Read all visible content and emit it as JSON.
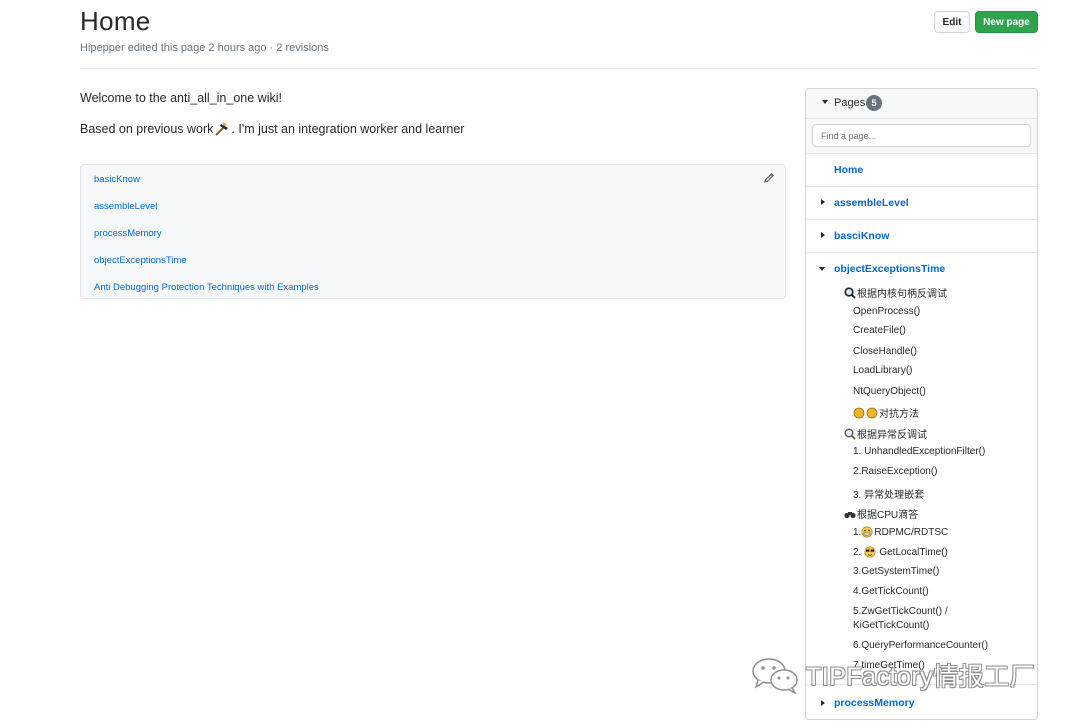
{
  "header": {
    "title": "Home",
    "meta": "Hipepper edited this page 2 hours ago · 2 revisions",
    "edit_label": "Edit",
    "new_page_label": "New page"
  },
  "content": {
    "welcome": "Welcome to the anti_all_in_one wiki!",
    "based_before": "Based on previous work",
    "based_after": ". I'm just an integration worker and learner",
    "links": [
      "basicKnow",
      "assembleLevel",
      "processMemory",
      "objectExceptionsTime",
      "Anti Debugging Protection Techniques with Examples"
    ]
  },
  "sidebar": {
    "title": "Pages",
    "count": "5",
    "search_placeholder": "Find a page...",
    "home": "Home",
    "assembleLevel": "assembleLevel",
    "basciKnow": "basciKnow",
    "objectExceptionsTime": "objectExceptionsTime",
    "processMemory": "processMemory",
    "toc": {
      "h1": "根据内核句柄反调试",
      "h1_items": [
        "OpenProcess()",
        "CreateFile()",
        "CloseHandle()",
        "LoadLibrary()",
        "NtQueryObject()"
      ],
      "h1_last": "对抗方法",
      "h2": "根据异常反调试",
      "h2_items": [
        "1. UnhandledExceptionFilter()",
        "2.RaiseException()",
        "3. 异常处理嵌套"
      ],
      "h3": "根据CPU滴答",
      "h3_item1": "RDPMC/RDTSC",
      "h3_item1_prefix": "1.",
      "h3_item2_prefix": "2.",
      "h3_item2": "GetLocalTime()",
      "h3_items": [
        "3.GetSystemTime()",
        "4.GetTickCount()",
        "5.ZwGetTickCount() / KiGetTickCount()",
        "6.QueryPerformanceCounter()",
        "7.timeGetTime()"
      ]
    }
  },
  "watermark": {
    "text": "TIPFactory情报工厂"
  },
  "colors": {
    "link": "#0366d6",
    "green_button": "#2ea44f",
    "badge": "#6a737d"
  }
}
